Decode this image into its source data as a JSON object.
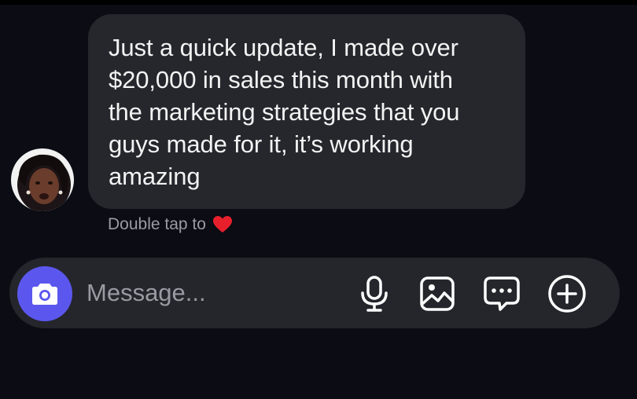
{
  "message": {
    "lines": [
      "Just a quick update, I made over",
      "$20,000 in sales this month with",
      "the marketing strategies that you",
      "guys made for it, it’s working",
      "amazing"
    ]
  },
  "reaction_hint": {
    "text": "Double tap to",
    "icon": "heart-icon",
    "icon_color": "#e8202c"
  },
  "composer": {
    "placeholder": "Message...",
    "camera_icon": "camera-icon",
    "camera_color": "#5b57ee",
    "tools": [
      "microphone-icon",
      "image-icon",
      "chat-bubble-icon",
      "plus-circle-icon"
    ]
  },
  "colors": {
    "background": "#0b0c14",
    "bubble": "#26272d",
    "composer": "#25262c",
    "hint_text": "#9b9ba3"
  }
}
